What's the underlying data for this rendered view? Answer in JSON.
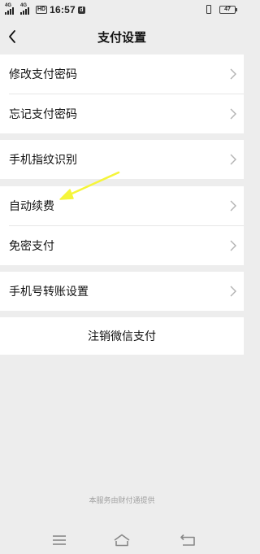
{
  "status_bar": {
    "network_1": "4G",
    "network_2": "4G",
    "hd_label": "HD",
    "time": "16:57",
    "app_badge": "d",
    "battery_level": "47"
  },
  "header": {
    "back_icon": "chevron-left-icon",
    "title": "支付设置"
  },
  "settings": {
    "group1": [
      {
        "label": "修改支付密码"
      },
      {
        "label": "忘记支付密码"
      }
    ],
    "group2": [
      {
        "label": "手机指纹识别"
      }
    ],
    "group3": [
      {
        "label": "自动续费"
      },
      {
        "label": "免密支付"
      }
    ],
    "group4": [
      {
        "label": "手机号转账设置"
      }
    ]
  },
  "cancel_button": {
    "label": "注销微信支付"
  },
  "footer": {
    "note": "本服务由财付通提供"
  },
  "annotation": {
    "arrow_color": "#f5f53a"
  },
  "bottom_nav": {
    "menu_icon": "menu-icon",
    "home_icon": "home-icon",
    "back_icon": "back-return-icon"
  }
}
